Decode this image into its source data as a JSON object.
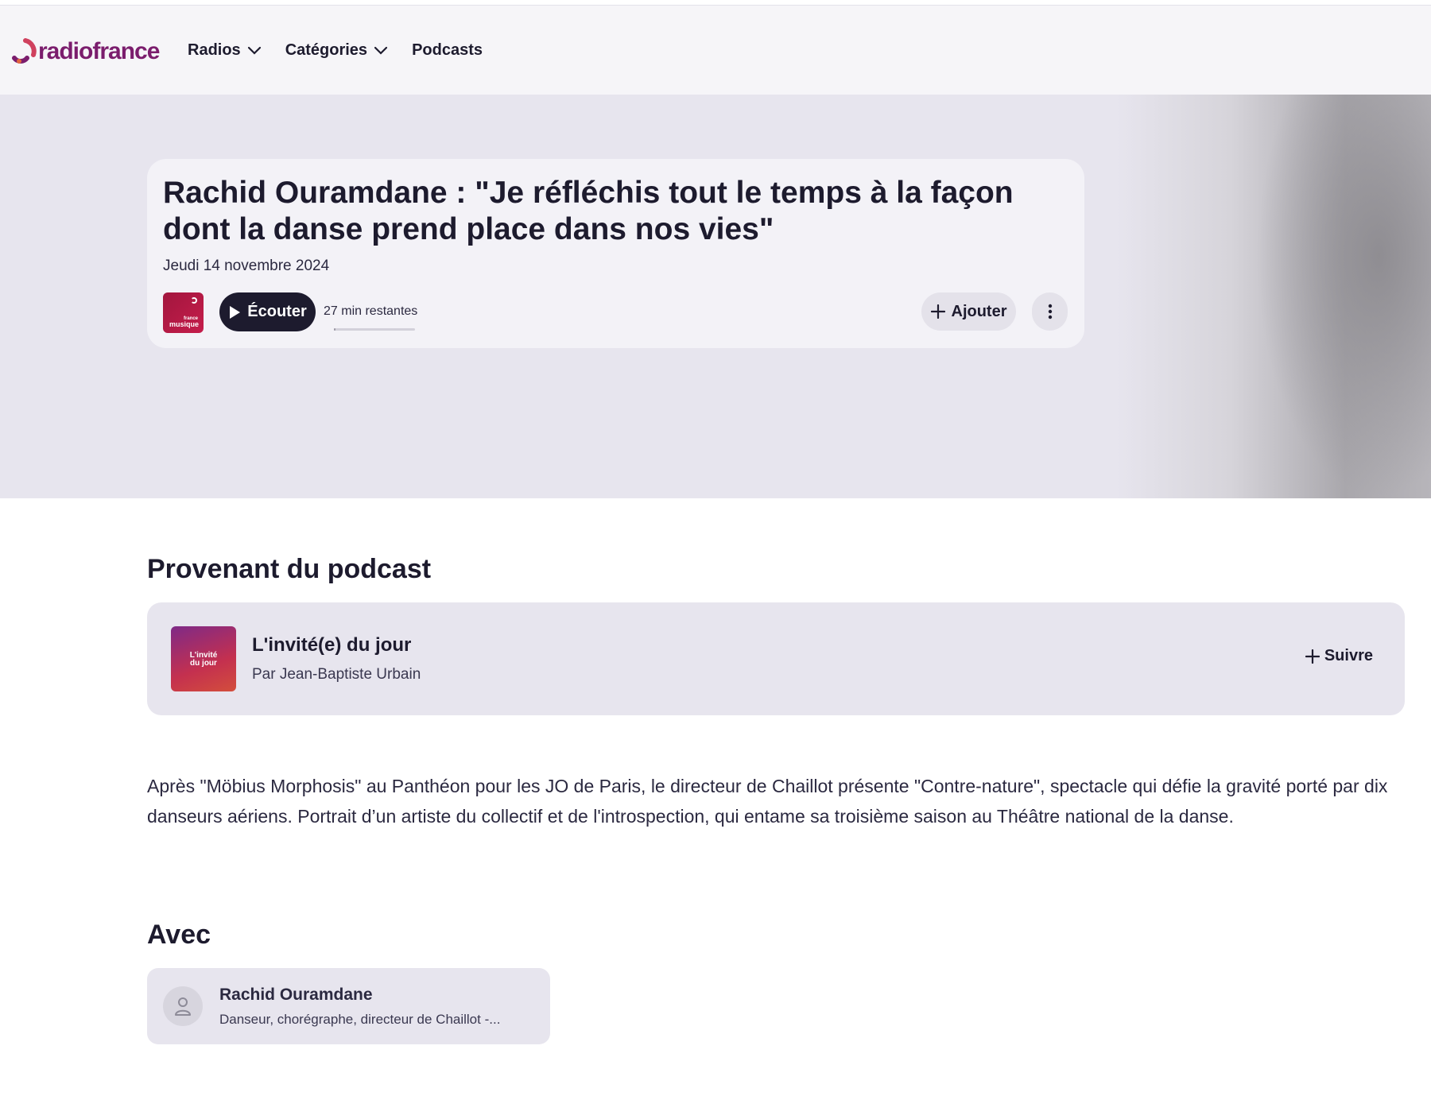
{
  "header": {
    "logo_text": "radiofrance",
    "nav": [
      {
        "label": "Radios",
        "has_dropdown": true
      },
      {
        "label": "Catégories",
        "has_dropdown": true
      },
      {
        "label": "Podcasts",
        "has_dropdown": false
      }
    ]
  },
  "episode": {
    "title": "Rachid Ouramdane : \"Je réfléchis tout le temps à la façon dont la danse prend place dans nos vies\"",
    "date": "Jeudi 14 novembre 2024",
    "station_logo": {
      "small": "france",
      "big": "musique"
    },
    "play_label": "Écouter",
    "remaining": "27 min restantes",
    "progress_fraction": 0.02,
    "add_label": "Ajouter"
  },
  "podcast_section": {
    "heading": "Provenant du podcast",
    "thumb_text_line1": "L'invité",
    "thumb_text_line2": "du jour",
    "title": "L'invité(e) du jour",
    "author": "Par Jean-Baptiste Urbain",
    "follow_label": "Suivre"
  },
  "description": "Après \"Möbius Morphosis\" au Panthéon pour les JO de Paris, le directeur de Chaillot présente \"Contre-nature\", spectacle qui défie la gravité porté par dix danseurs aériens. Portrait d’un artiste du collectif et de l'introspection, qui entame sa troisième saison au Théâtre national de la danse.",
  "guests_section": {
    "heading": "Avec",
    "guests": [
      {
        "name": "Rachid Ouramdane",
        "role": "Danseur, chorégraphe, directeur de Chaillot -..."
      }
    ]
  },
  "colors": {
    "dark": "#1d1b2e",
    "hero_bg": "#e7e5ee",
    "card_bg": "#f3f2f7",
    "brand_purple": "#7b1d6d"
  }
}
